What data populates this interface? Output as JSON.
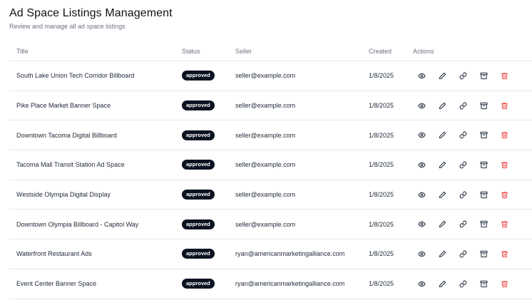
{
  "header": {
    "title": "Ad Space Listings Management",
    "subtitle": "Review and manage all ad space listings"
  },
  "table": {
    "columns": [
      "Title",
      "Status",
      "Seller",
      "Created",
      "Actions"
    ],
    "rows": [
      {
        "title": "South Lake Union Tech Corridor Billboard",
        "status": "approved",
        "seller": "seller@example.com",
        "created": "1/8/2025"
      },
      {
        "title": "Pike Place Market Banner Space",
        "status": "approved",
        "seller": "seller@example.com",
        "created": "1/8/2025"
      },
      {
        "title": "Downtown Tacoma Digital Billboard",
        "status": "approved",
        "seller": "seller@example.com",
        "created": "1/8/2025"
      },
      {
        "title": "Tacoma Mall Transit Station Ad Space",
        "status": "approved",
        "seller": "seller@example.com",
        "created": "1/8/2025"
      },
      {
        "title": "Westside Olympia Digital Display",
        "status": "approved",
        "seller": "seller@example.com",
        "created": "1/8/2025"
      },
      {
        "title": "Downtown Olympia Billboard - Capitol Way",
        "status": "approved",
        "seller": "seller@example.com",
        "created": "1/8/2025"
      },
      {
        "title": "Waterfront Restaurant Ads",
        "status": "approved",
        "seller": "ryan@americanmarketingalliance.com",
        "created": "1/8/2025"
      },
      {
        "title": "Event Center Banner Space",
        "status": "approved",
        "seller": "ryan@americanmarketingalliance.com",
        "created": "1/8/2025"
      }
    ],
    "actions": [
      {
        "key": "view",
        "icon": "eye-icon"
      },
      {
        "key": "edit",
        "icon": "pencil-icon"
      },
      {
        "key": "link",
        "icon": "link-icon"
      },
      {
        "key": "archive",
        "icon": "archive-icon"
      },
      {
        "key": "delete",
        "icon": "trash-icon"
      }
    ]
  },
  "colors": {
    "badge_bg": "#0b1220",
    "icon": "#1f2937",
    "delete_icon": "#ef4444",
    "divider": "#e5e7eb"
  }
}
